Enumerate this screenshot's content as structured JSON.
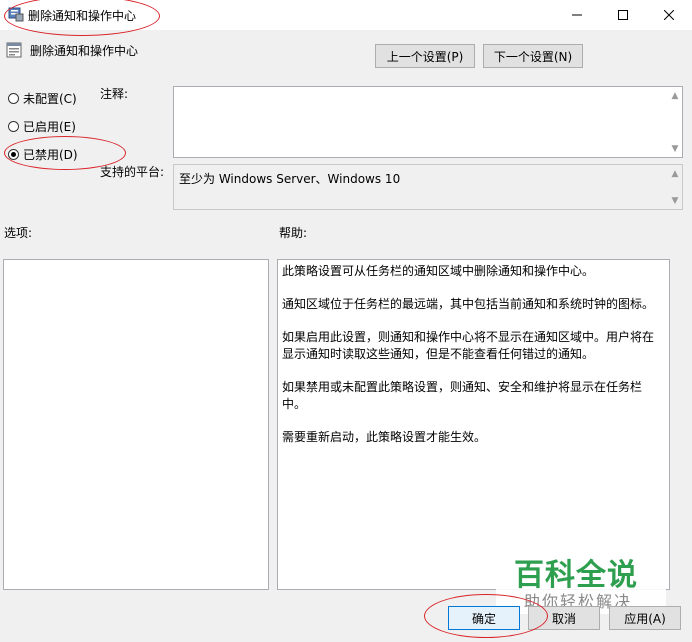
{
  "window": {
    "title": "删除通知和操作中心",
    "minimize_glyph": "—",
    "maximize_glyph": "☐",
    "close_glyph": "✕"
  },
  "policy_name": "删除通知和操作中心",
  "nav": {
    "prev_label": "上一个设置(P)",
    "next_label": "下一个设置(N)"
  },
  "options": [
    {
      "label": "未配置(C)",
      "checked": false
    },
    {
      "label": "已启用(E)",
      "checked": false
    },
    {
      "label": "已禁用(D)",
      "checked": true
    }
  ],
  "comment_label": "注释:",
  "platform_label": "支持的平台:",
  "platform_value": "至少为 Windows Server、Windows 10",
  "options_label": "选项:",
  "help_label": "帮助:",
  "help_paragraphs": [
    "此策略设置可从任务栏的通知区域中删除通知和操作中心。",
    "通知区域位于任务栏的最远端，其中包括当前通知和系统时钟的图标。",
    "如果启用此设置，则通知和操作中心将不显示在通知区域中。用户将在显示通知时读取这些通知，但是不能查看任何错过的通知。",
    "如果禁用或未配置此策略设置，则通知、安全和维护将显示在任务栏中。",
    "需要重新启动，此策略设置才能生效。"
  ],
  "footer": {
    "ok_label": "确定",
    "cancel_label": "取消",
    "apply_label": "应用(A)"
  },
  "watermark": {
    "title": "百科全说",
    "subtitle": "助你轻松解决"
  },
  "colors": {
    "annotation_red": "#d9252a",
    "watermark_green": "#2e9e4f"
  }
}
